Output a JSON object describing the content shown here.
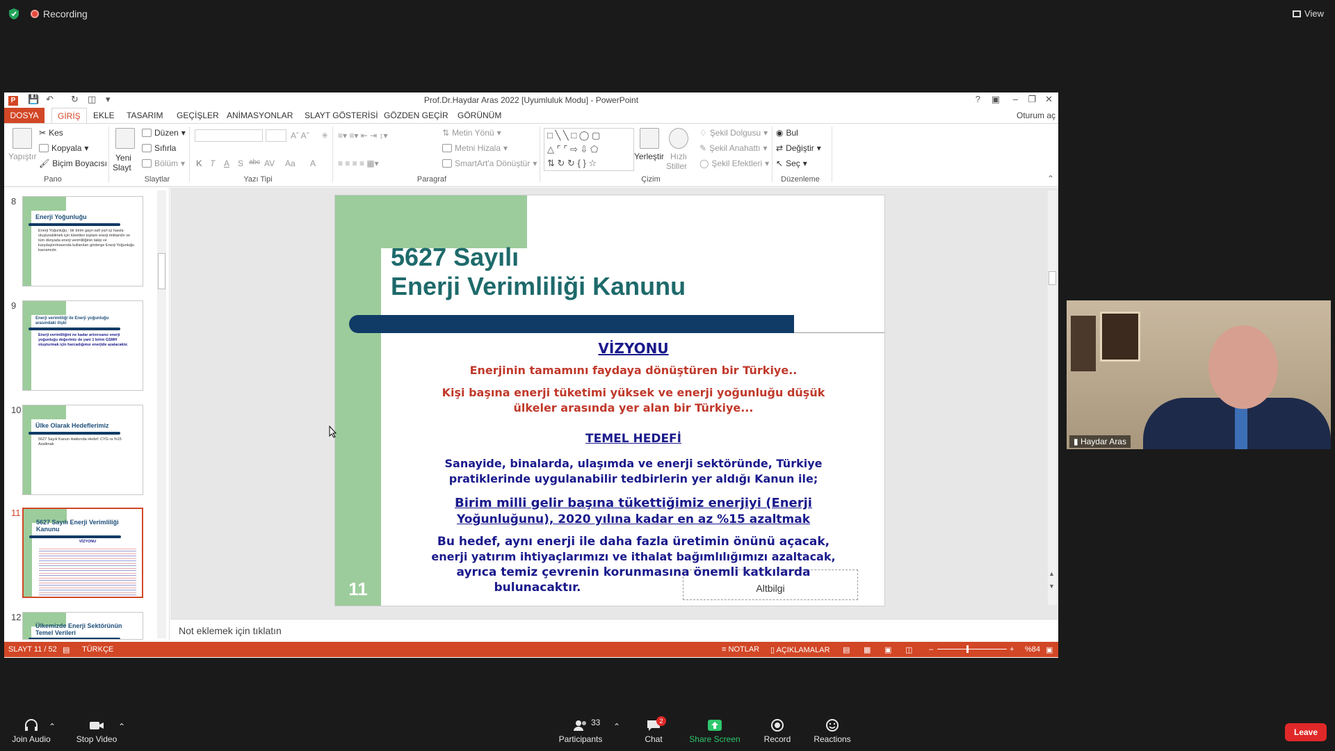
{
  "zoom": {
    "recording_label": "Recording",
    "view_label": "View",
    "toolbar": {
      "join_audio": "Join Audio",
      "stop_video": "Stop Video",
      "participants": "Participants",
      "participants_count": "33",
      "chat": "Chat",
      "chat_badge": "2",
      "share_screen": "Share Screen",
      "record": "Record",
      "reactions": "Reactions",
      "leave": "Leave"
    },
    "video": {
      "name": "Haydar Aras"
    }
  },
  "ppt": {
    "window_title": "Prof.Dr.Haydar Aras  2022 [Uyumluluk Modu] - PowerPoint",
    "tabs": [
      "DOSYA",
      "GİRİŞ",
      "EKLE",
      "TASARIM",
      "GEÇİŞLER",
      "ANİMASYONLAR",
      "SLAYT GÖSTERİSİ",
      "GÖZDEN GEÇİR",
      "GÖRÜNÜM"
    ],
    "sign_in": "Oturum aç",
    "ribbon": {
      "pano": {
        "label": "Pano",
        "paste": "Yapıştır",
        "cut": "Kes",
        "copy": "Kopyala",
        "format_painter": "Biçim Boyacısı"
      },
      "slaytlar": {
        "label": "Slaytlar",
        "new_slide_1": "Yeni",
        "new_slide_2": "Slayt",
        "layout": "Düzen",
        "reset": "Sıfırla",
        "section": "Bölüm"
      },
      "yazi_tipi": {
        "label": "Yazı Tipi",
        "bold": "K",
        "italic": "T",
        "underline": "A",
        "shadow": "S",
        "strike": "abc",
        "spacing": "AV",
        "case": "Aa",
        "color": "A"
      },
      "paragraf": {
        "label": "Paragraf",
        "text_dir": "Metin Yönü",
        "align_text": "Metni Hizala",
        "smartart": "SmartArt'a Dönüştür"
      },
      "cizim": {
        "label": "Çizim",
        "arrange": "Yerleştir",
        "quick_1": "Hızlı",
        "quick_2": "Stiller",
        "fill": "Şekil Dolgusu",
        "outline": "Şekil Anahattı",
        "effects": "Şekil Efektleri"
      },
      "duzenleme": {
        "label": "Düzenleme",
        "find": "Bul",
        "replace": "Değiştir",
        "select": "Seç"
      }
    },
    "thumbnails": [
      {
        "num": "8",
        "title": "Enerji Yoğunluğu",
        "text": "Enerji Yoğunluğu : bir birim gayri safi yurt içi hasıla oluşturabilmek için tüketilen toplam enerji miktarıdır ve tüm dünyada enerji verimliliğinin takip ve karşılaştırılmasında kullanılan gösterge Enerji Yoğunluğu kavramıdır."
      },
      {
        "num": "9",
        "title": "Enerji verimliliği ile Enerji yoğunluğu arasındaki ilişki",
        "text": "Enerji verimliliğini ne kadar artırırsanız enerji yoğunluğu değerimiz de yani 1 birim GSMH oluşturmak için harcadığımız enerjide azalacaktır."
      },
      {
        "num": "10",
        "title": "Ülke Olarak Hedeflerimiz",
        "text": "5627 Sayılı Kanun Hakkında Hedef: CYG ra %15 Azaltmak"
      },
      {
        "num": "11",
        "title": "5627 Sayılı Enerji Verimliliği Kanunu",
        "text": "VİZYONU"
      },
      {
        "num": "12",
        "title": "Ülkemizde Enerji Sektörünün Temel Verileri",
        "text": ""
      }
    ],
    "slide": {
      "title_line1": "5627 Sayılı",
      "title_line2": "Enerji Verimliliği Kanunu",
      "vision_heading": "VİZYONU",
      "vision_1": "Enerjinin tamamını faydaya dönüştüren bir Türkiye..",
      "vision_2a": "Kişi başına enerji tüketimi yüksek ve enerji yoğunluğu düşük",
      "vision_2b": "ülkeler arasında yer alan bir Türkiye...",
      "goal_heading": "TEMEL HEDEFİ",
      "goal_1a": "Sanayide, binalarda, ulaşımda ve enerji sektöründe, Türkiye",
      "goal_1b": "pratiklerinde uygulanabilir tedbirlerin yer aldığı Kanun ile;",
      "goal_2a": "Birim milli gelir başına tükettiğimiz enerjiyi (Enerji",
      "goal_2b": "Yoğunluğunu), 2020 yılına kadar  en az %15 azaltmak",
      "goal_3a": "Bu hedef,  aynı enerji ile daha fazla üretimin önünü açacak,",
      "goal_3b": "enerji yatırım ihtiyaçlarımızı ve ithalat bağımlılığımızı azaltacak,",
      "goal_3c": "ayrıca temiz çevrenin korunmasına önemli katkılarda",
      "goal_3d": "bulunacaktır.",
      "number": "11",
      "footer": "Altbilgi"
    },
    "notes_placeholder": "Not eklemek için tıklatın",
    "status": {
      "slide": "SLAYT 11 / 52",
      "language": "TÜRKÇE",
      "notes": "NOTLAR",
      "comments": "AÇIKLAMALAR",
      "zoom": "%84"
    },
    "colors": {
      "accent": "#d24726",
      "slide_green": "#9ccc9b",
      "slide_blue": "#0f3b66",
      "title_teal": "#1e6a6b",
      "text_red": "#c0392b",
      "text_navy": "#1a1a8c"
    }
  }
}
